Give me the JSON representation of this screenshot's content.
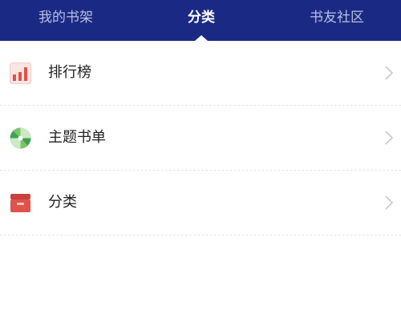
{
  "tabs": [
    {
      "label": "我的书架",
      "active": false
    },
    {
      "label": "分类",
      "active": true
    },
    {
      "label": "书友社区",
      "active": false
    }
  ],
  "colors": {
    "header_bg": "#1a2a84",
    "tab_active": "#ffffff",
    "tab_inactive": "#b9bfe0",
    "text": "#222222"
  },
  "rows": [
    {
      "label": "排行榜",
      "icon": "bar-chart-icon"
    },
    {
      "label": "主题书单",
      "icon": "candy-swirl-icon"
    },
    {
      "label": "分类",
      "icon": "box-icon"
    }
  ]
}
